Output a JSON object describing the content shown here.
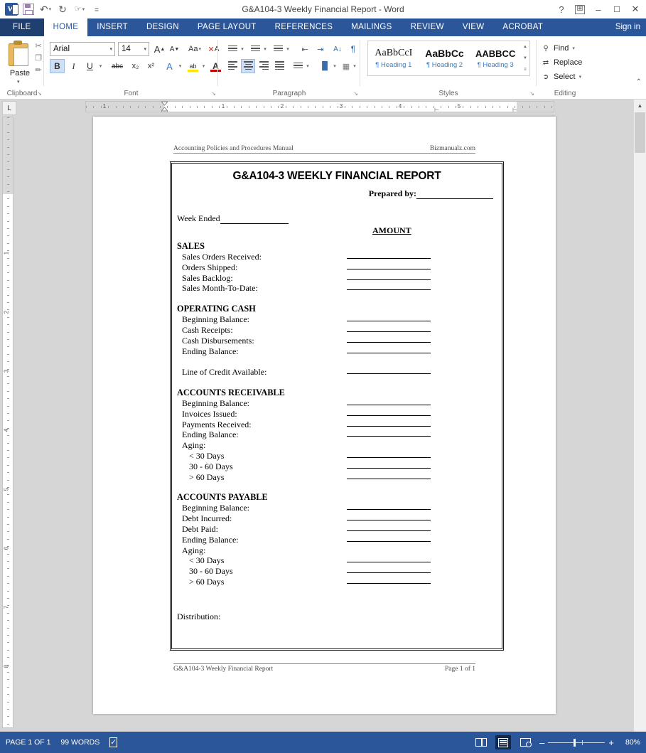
{
  "window": {
    "title": "G&A104-3 Weekly Financial Report - Word",
    "help_icon": "?",
    "ribbon_display_icon": "ribbon-display-options",
    "minimize": "–",
    "restore": "❐",
    "close": "✕",
    "sign_in": "Sign in"
  },
  "quick_access": {
    "app_icon": "word-logo-icon",
    "save_icon": "save-icon",
    "undo_icon": "↶",
    "redo_icon": "↻",
    "touch_icon": "touch-mode-icon",
    "customize_icon": "≡"
  },
  "tabs": [
    {
      "label": "FILE",
      "active": false,
      "file": true
    },
    {
      "label": "HOME",
      "active": true,
      "file": false
    },
    {
      "label": "INSERT",
      "active": false,
      "file": false
    },
    {
      "label": "DESIGN",
      "active": false,
      "file": false
    },
    {
      "label": "PAGE LAYOUT",
      "active": false,
      "file": false
    },
    {
      "label": "REFERENCES",
      "active": false,
      "file": false
    },
    {
      "label": "MAILINGS",
      "active": false,
      "file": false
    },
    {
      "label": "REVIEW",
      "active": false,
      "file": false
    },
    {
      "label": "VIEW",
      "active": false,
      "file": false
    },
    {
      "label": "ACROBAT",
      "active": false,
      "file": false
    }
  ],
  "ribbon": {
    "clipboard": {
      "group_label": "Clipboard",
      "paste_label": "Paste",
      "cut_icon": "scissors-icon",
      "copy_icon": "copy-icon",
      "format_painter_icon": "format-painter-icon",
      "dialog_launcher": "↘"
    },
    "font": {
      "group_label": "Font",
      "font_name": "Arial",
      "font_size": "14",
      "grow_font": "A",
      "shrink_font": "A",
      "change_case": "Aa",
      "clear_formatting_icon": "clear-formatting-icon",
      "bold": "B",
      "italic": "I",
      "underline": "U",
      "strikethrough": "abc",
      "subscript": "x₂",
      "superscript": "x²",
      "text_effects": "A",
      "highlight": "ab",
      "font_color": "A",
      "bold_active": true,
      "dialog_launcher": "↘"
    },
    "paragraph": {
      "group_label": "Paragraph",
      "bullets_icon": "bullets-icon",
      "numbering_icon": "numbering-icon",
      "multilevel_icon": "multilevel-list-icon",
      "decrease_indent_icon": "decrease-indent-icon",
      "increase_indent_icon": "increase-indent-icon",
      "sort_icon": "sort-icon",
      "show_marks_icon": "¶",
      "align_left_icon": "align-left-icon",
      "align_center_icon": "align-center-icon",
      "align_right_icon": "align-right-icon",
      "justify_icon": "justify-icon",
      "line_spacing_icon": "line-spacing-icon",
      "shading_icon": "shading-icon",
      "borders_icon": "borders-icon",
      "center_active": true,
      "dialog_launcher": "↘"
    },
    "styles": {
      "group_label": "Styles",
      "items": [
        {
          "preview": "AaBbCcI",
          "name": "¶ Heading 1"
        },
        {
          "preview": "AaBbCc",
          "name": "¶ Heading 2"
        },
        {
          "preview": "AABBCC",
          "name": "¶ Heading 3"
        }
      ],
      "scroll_up": "▲",
      "scroll_down": "▼",
      "more": "≡",
      "dialog_launcher": "↘"
    },
    "editing": {
      "group_label": "Editing",
      "find_label": "Find",
      "find_icon": "binoculars-icon",
      "replace_label": "Replace",
      "replace_icon": "replace-icon",
      "select_label": "Select",
      "select_icon": "cursor-arrow-icon",
      "caret": "▾",
      "collapse_ribbon": "⌃"
    }
  },
  "ruler": {
    "tab_selector_icon": "tab-stop-selector-icon",
    "h_labels": [
      "1",
      "1",
      "2",
      "3",
      "4",
      "5"
    ],
    "v_labels": [
      "1",
      "2",
      "3",
      "4",
      "5",
      "6",
      "7",
      "8"
    ],
    "tab_stop_icon": "L"
  },
  "document": {
    "header": {
      "left": "Accounting Policies and Procedures Manual",
      "right": "Bizmanualz.com"
    },
    "footer": {
      "left": "G&A104-3 Weekly Financial Report",
      "right": "Page 1 of 1"
    },
    "title": "G&A104-3 WEEKLY FINANCIAL REPORT",
    "prepared_by_label": "Prepared by:",
    "week_ended_label": "Week Ended",
    "amount_header": "AMOUNT",
    "distribution_label": "Distribution:",
    "sections": [
      {
        "heading": "SALES",
        "rows": [
          {
            "label": "Sales Orders Received:",
            "line": true,
            "sub": false
          },
          {
            "label": "Orders Shipped:",
            "line": true,
            "sub": false
          },
          {
            "label": "Sales Backlog:",
            "line": true,
            "sub": false
          },
          {
            "label": "Sales Month-To-Date:",
            "line": true,
            "sub": false
          }
        ]
      },
      {
        "heading": "OPERATING CASH",
        "rows": [
          {
            "label": "Beginning Balance:",
            "line": true,
            "sub": false
          },
          {
            "label": "Cash Receipts:",
            "line": true,
            "sub": false
          },
          {
            "label": "Cash Disbursements:",
            "line": true,
            "sub": false
          },
          {
            "label": "Ending Balance:",
            "line": true,
            "sub": false
          },
          {
            "label": "",
            "line": false,
            "sub": false
          },
          {
            "label": "Line of Credit Available:",
            "line": true,
            "sub": false
          }
        ]
      },
      {
        "heading": "ACCOUNTS RECEIVABLE",
        "rows": [
          {
            "label": "Beginning Balance:",
            "line": true,
            "sub": false
          },
          {
            "label": "Invoices Issued:",
            "line": true,
            "sub": false
          },
          {
            "label": "Payments Received:",
            "line": true,
            "sub": false
          },
          {
            "label": "Ending Balance:",
            "line": true,
            "sub": false
          },
          {
            "label": "Aging:",
            "line": false,
            "sub": false
          },
          {
            "label": "< 30    Days",
            "line": true,
            "sub": true
          },
          {
            "label": "30 - 60 Days",
            "line": true,
            "sub": true
          },
          {
            "label": "> 60    Days",
            "line": true,
            "sub": true
          }
        ]
      },
      {
        "heading": "ACCOUNTS PAYABLE",
        "rows": [
          {
            "label": "Beginning Balance:",
            "line": true,
            "sub": false
          },
          {
            "label": "Debt Incurred:",
            "line": true,
            "sub": false
          },
          {
            "label": "Debt Paid:",
            "line": true,
            "sub": false
          },
          {
            "label": "Ending Balance:",
            "line": true,
            "sub": false
          },
          {
            "label": "Aging:",
            "line": false,
            "sub": false
          },
          {
            "label": "< 30    Days",
            "line": true,
            "sub": true
          },
          {
            "label": "30 - 60 Days",
            "line": true,
            "sub": true
          },
          {
            "label": "> 60    Days",
            "line": true,
            "sub": true
          }
        ]
      }
    ]
  },
  "status_bar": {
    "page_indicator": "PAGE 1 OF 1",
    "word_count": "99 WORDS",
    "proofing_icon": "proofing-errors-icon",
    "read_mode_icon": "read-mode-icon",
    "print_layout_icon": "print-layout-icon",
    "web_layout_icon": "web-layout-icon",
    "zoom_out": "–",
    "zoom_in": "+",
    "zoom_level": "80%"
  },
  "colors": {
    "brand_blue": "#2b579a",
    "file_tab": "#1e3f70",
    "canvas_gray": "#d6d6d6",
    "accent_highlight": "#cfe0f5"
  }
}
